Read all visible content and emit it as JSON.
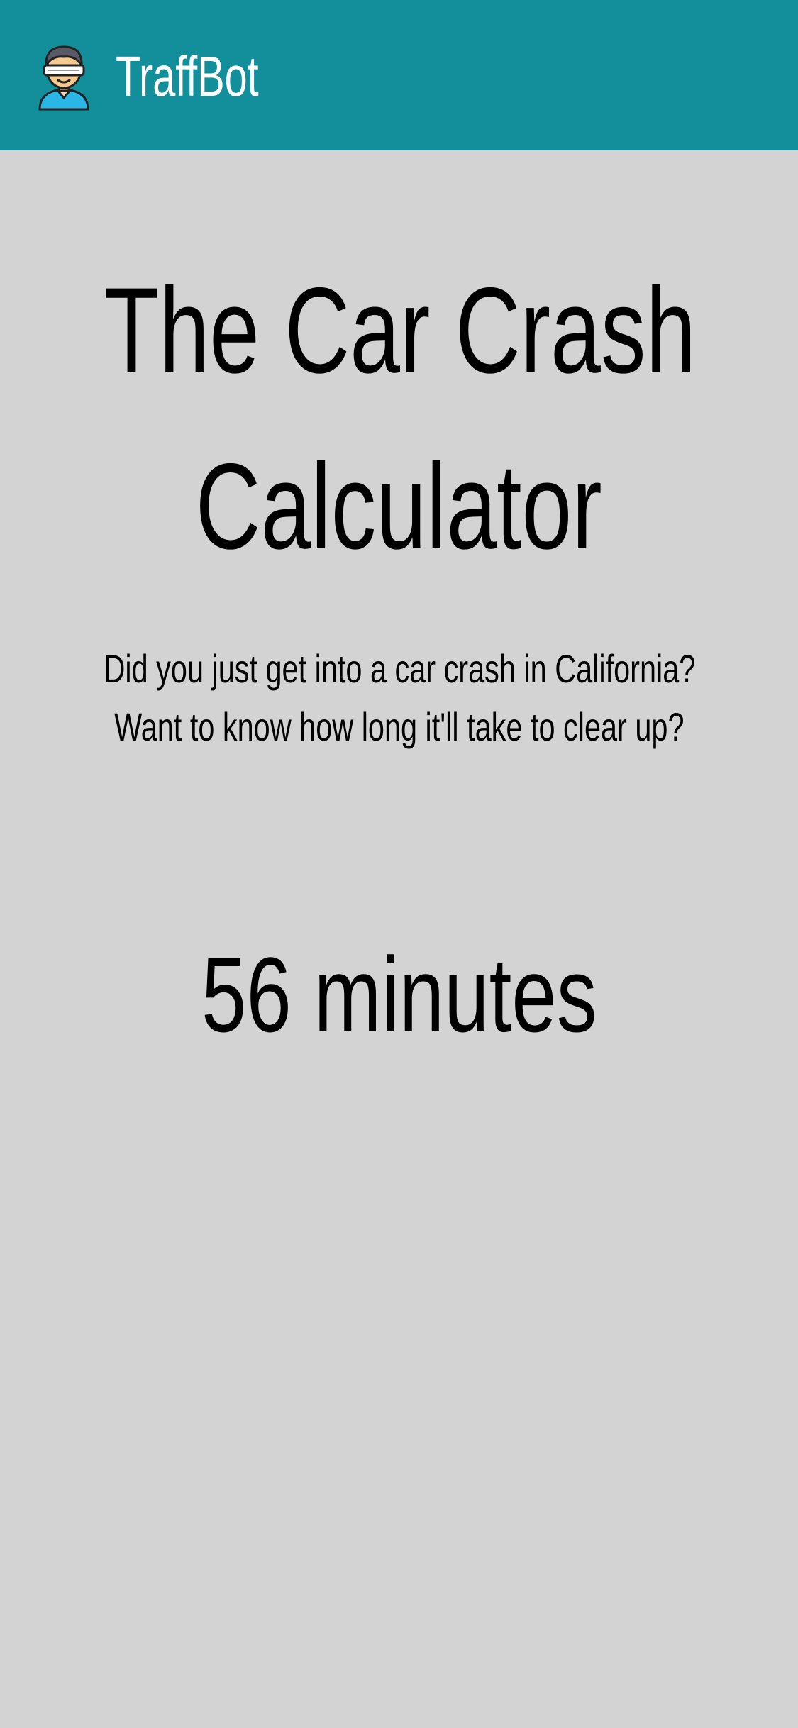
{
  "header": {
    "app_name": "TraffBot",
    "logo_icon": "driver-avatar-icon",
    "background_color": "#138f9c"
  },
  "main": {
    "title_line1": "The Car Crash",
    "title_line2": "Calculator",
    "subtitle_line1": "Did you just get into a car crash in California?",
    "subtitle_line2": "Want to know how long it'll take to clear up?",
    "result": "56 minutes",
    "background_color": "#d3d3d3"
  }
}
